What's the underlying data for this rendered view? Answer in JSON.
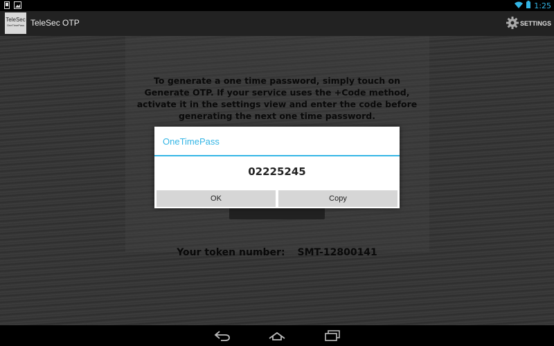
{
  "status_bar": {
    "time": "1:25",
    "icons": [
      "phone-notification-icon",
      "image-notification-icon",
      "wifi-icon",
      "battery-icon"
    ],
    "accent_color": "#33b5e5"
  },
  "action_bar": {
    "logo_text": "TeleSec",
    "logo_subtext": "OneTimePass",
    "title": "TeleSec OTP",
    "settings_label": "SETTINGS",
    "settings_icon": "gear-icon"
  },
  "main": {
    "instructions": "To generate a one time password, simply touch on Generate OTP. If your service uses the +Code method, activate it in the settings view and enter the code before generating the next one time password.",
    "token_label": "Your token number:",
    "token_value": "SMT-12800141"
  },
  "dialog": {
    "title": "OneTimePass",
    "message": "02225245",
    "ok_label": "OK",
    "copy_label": "Copy",
    "accent_color": "#33b5e5"
  },
  "nav_bar": {
    "icons": [
      "back-icon",
      "home-icon",
      "recent-apps-icon"
    ]
  }
}
